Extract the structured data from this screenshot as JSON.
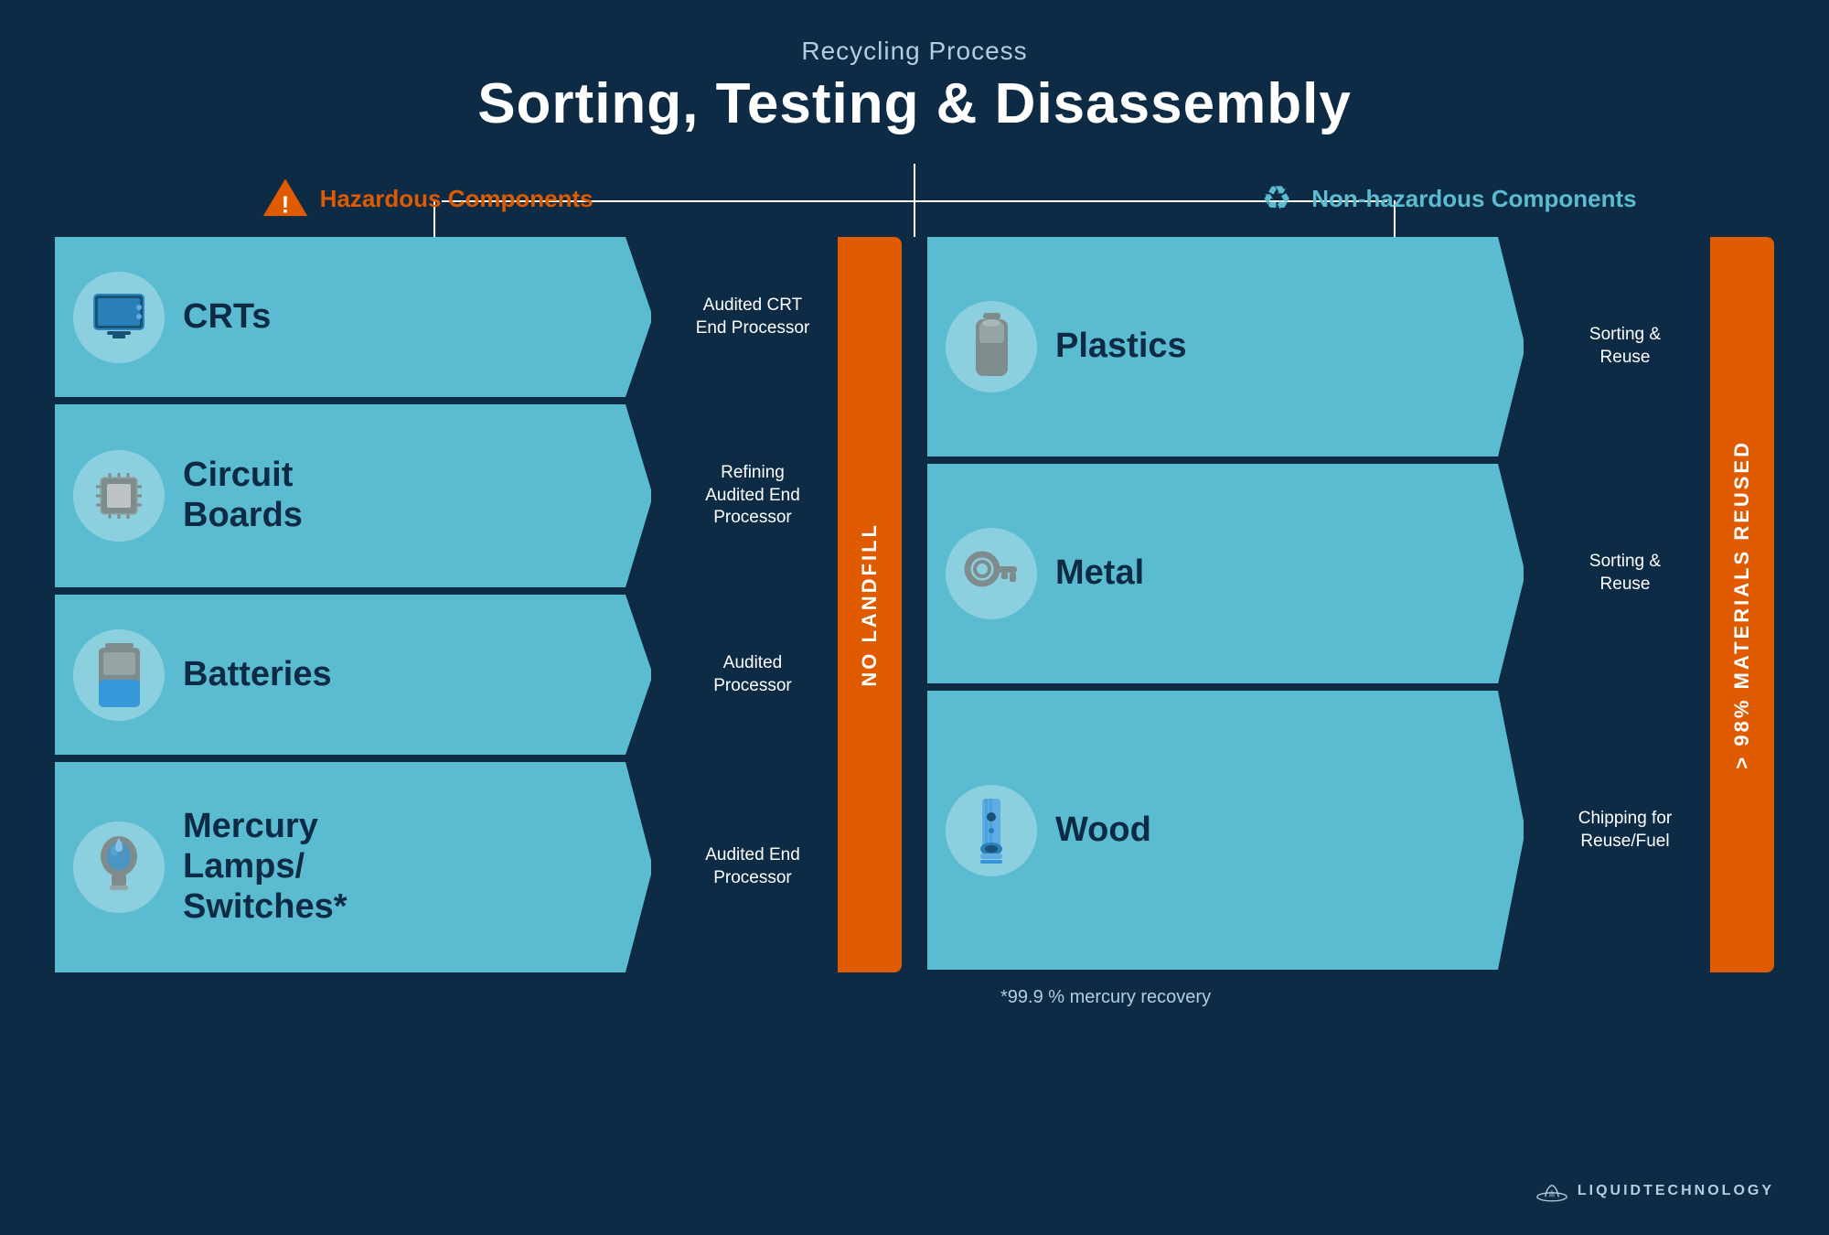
{
  "header": {
    "subtitle": "Recycling Process",
    "title": "Sorting, Testing & Disassembly"
  },
  "left_section": {
    "label": "Hazardous Components",
    "items": [
      {
        "name": "CRTs",
        "processor": "Audited CRT\nEnd Processor",
        "icon": "tv"
      },
      {
        "name": "Circuit\nBoards",
        "processor": "Refining\nAudited End\nProcessor",
        "icon": "chip"
      },
      {
        "name": "Batteries",
        "processor": "Audited\nProcessor",
        "icon": "battery"
      },
      {
        "name": "Mercury\nLamps/\nSwitches*",
        "processor": "Audited End\nProcessor",
        "icon": "bulb"
      }
    ],
    "banner": "NO LANDFILL"
  },
  "right_section": {
    "label": "Non-hazardous Components",
    "items": [
      {
        "name": "Plastics",
        "processor": "Sorting &\nReuse",
        "icon": "plastic"
      },
      {
        "name": "Metal",
        "processor": "Sorting &\nReuse",
        "icon": "key"
      },
      {
        "name": "Wood",
        "processor": "Chipping for\nReuse/Fuel",
        "icon": "wood"
      }
    ],
    "banner": "> 98% MATERIALS REUSED"
  },
  "footnote": "*99.9 % mercury recovery",
  "logo": {
    "name": "LIQUIDTECHNOLOGY"
  }
}
